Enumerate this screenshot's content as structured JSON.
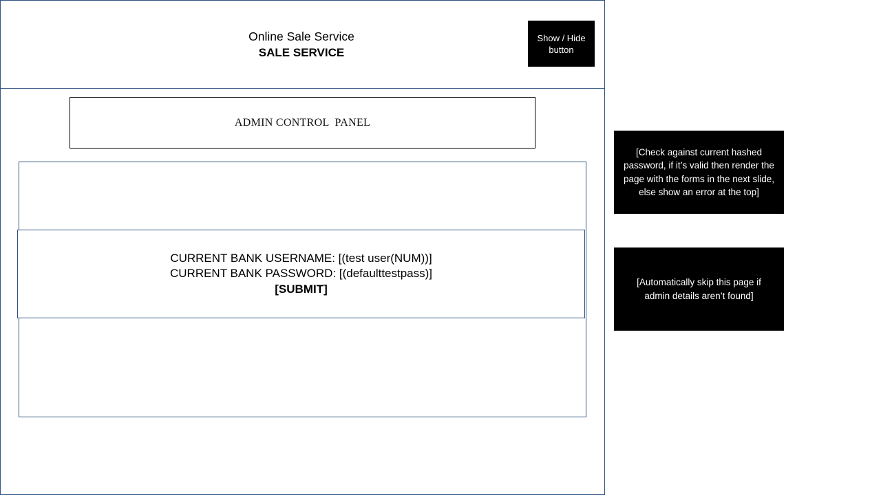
{
  "header": {
    "app_name": "Online Sale Service",
    "service_name": "SALE SERVICE",
    "show_hide_label": "Show / Hide\nbutton"
  },
  "admin_panel": {
    "title": "ADMIN CONTROL  PANEL"
  },
  "form": {
    "username_line": "CURRENT BANK USERNAME: [(test user(NUM))]",
    "password_line": "CURRENT BANK PASSWORD: [(defaulttestpass)]",
    "submit_label": "[SUBMIT]"
  },
  "notes": {
    "check_note": "[Check against current hashed password, if it’s valid then render the page with the forms in the next slide, else show an error  at the top]",
    "skip_note": "[Automatically skip this page if admin details aren’t found]"
  },
  "colors": {
    "frame_border": "#2f5283",
    "note_background": "#000000",
    "note_text": "#ffffff"
  }
}
